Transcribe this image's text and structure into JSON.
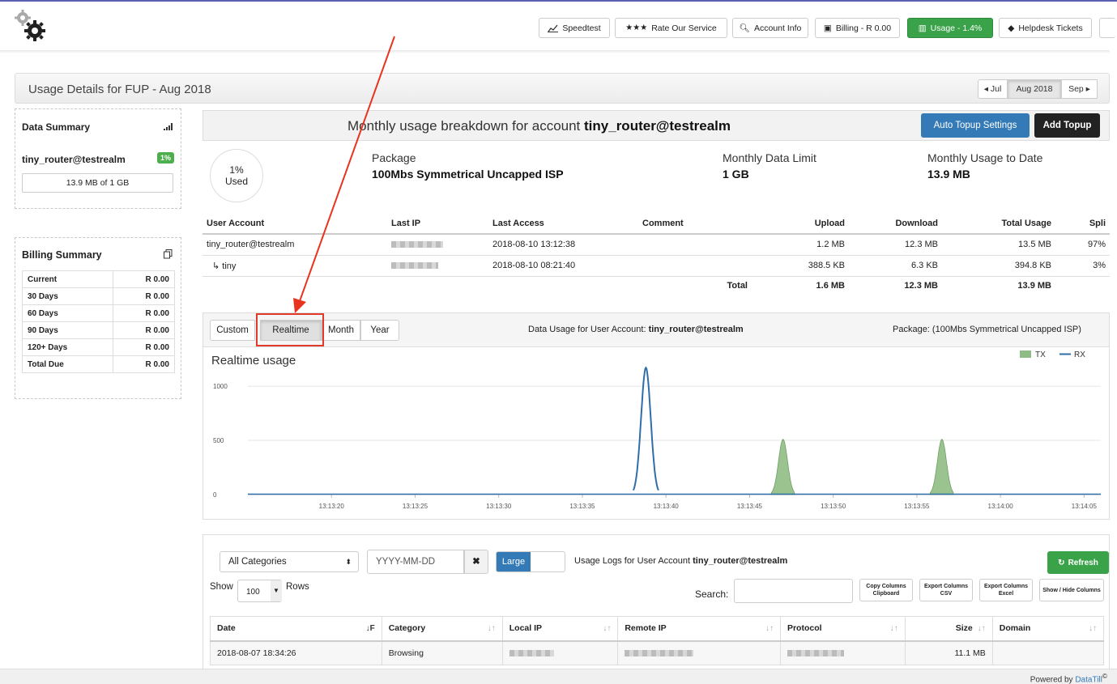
{
  "nav": {
    "speedtest": "Speedtest",
    "rate": "Rate Our Service",
    "account": "Account Info",
    "billing": "Billing - R 0.00",
    "usage": "Usage - 1.4%",
    "helpdesk": "Helpdesk Tickets"
  },
  "header": {
    "title": "Usage Details for FUP - Aug 2018",
    "prev": "◂ Jul",
    "current": "Aug 2018",
    "next": "Sep ▸"
  },
  "data_summary": {
    "title": "Data Summary",
    "user": "tiny_router@testrealm",
    "percent": "1%",
    "usage": "13.9 MB of 1 GB"
  },
  "billing_summary": {
    "title": "Billing Summary",
    "rows": [
      {
        "label": "Current",
        "value": "R 0.00"
      },
      {
        "label": "30 Days",
        "value": "R 0.00"
      },
      {
        "label": "60 Days",
        "value": "R 0.00"
      },
      {
        "label": "90 Days",
        "value": "R 0.00"
      },
      {
        "label": "120+ Days",
        "value": "R 0.00"
      },
      {
        "label": "Total Due",
        "value": "R 0.00"
      }
    ]
  },
  "breakdown": {
    "title_prefix": "Monthly usage breakdown for account ",
    "account": "tiny_router@testrealm",
    "auto_topup": "Auto Topup Settings",
    "add_topup": "Add Topup",
    "used_pct": "1%",
    "used_label": "Used",
    "package_label": "Package",
    "package_value": "100Mbs Symmetrical Uncapped ISP",
    "limit_label": "Monthly Data Limit",
    "limit_value": "1 GB",
    "todate_label": "Monthly Usage to Date",
    "todate_value": "13.9 MB"
  },
  "accounts_table": {
    "headers": [
      "User Account",
      "Last IP",
      "Last Access",
      "Comment",
      "Upload",
      "Download",
      "Total Usage",
      "Spli"
    ],
    "rows": [
      {
        "account": "tiny_router@testrealm",
        "last_access": "2018-08-10 13:12:38",
        "upload": "1.2 MB",
        "download": "12.3 MB",
        "total": "13.5 MB",
        "split": "97%"
      },
      {
        "account": "↳ tiny",
        "last_access": "2018-08-10 08:21:40",
        "upload": "388.5 KB",
        "download": "6.3 KB",
        "total": "394.8 KB",
        "split": "3%"
      }
    ],
    "total_label": "Total",
    "total_upload": "1.6 MB",
    "total_download": "12.3 MB",
    "total_usage": "13.9 MB"
  },
  "chart_panel": {
    "tabs": [
      "Custom",
      "Realtime",
      "Month",
      "Year"
    ],
    "active_tab": "Realtime",
    "account_prefix": "Data Usage for User Account: ",
    "account": "tiny_router@testrealm",
    "package": "Package:  (100Mbs Symmetrical Uncapped ISP)"
  },
  "chart_data": {
    "type": "area",
    "title": "Realtime usage",
    "legend_position": "top-right",
    "ylim": [
      0,
      1150
    ],
    "y_ticks": [
      0,
      500,
      1000
    ],
    "x_ticks": [
      "13:13:20",
      "13:13:25",
      "13:13:30",
      "13:13:35",
      "13:13:40",
      "13:13:45",
      "13:13:50",
      "13:13:55",
      "13:14:00",
      "13:14:05"
    ],
    "x_range_seconds": [
      15,
      66
    ],
    "series": [
      {
        "name": "TX",
        "color": "#8fbc84",
        "peaks": [
          {
            "t": 47,
            "value": 510
          },
          {
            "t": 56.5,
            "value": 510
          }
        ]
      },
      {
        "name": "RX",
        "color": "#2f6ea8",
        "peaks": [
          {
            "t": 38.8,
            "value": 1170
          }
        ]
      }
    ]
  },
  "logs": {
    "category": "All Categories",
    "date_placeholder": "YYYY-MM-DD",
    "large": "Large",
    "title_prefix": "Usage Logs for User Account ",
    "account": "tiny_router@testrealm",
    "refresh": "Refresh",
    "show": "Show",
    "rows_count": "100",
    "rows_label": "Rows",
    "search_label": "Search:",
    "btn_copy": "Copy Columns Clipboard",
    "btn_csv": "Export Columns CSV",
    "btn_excel": "Export Columns Excel",
    "btn_showhide": "Show / Hide Columns",
    "headers": [
      "Date",
      "Category",
      "Local IP",
      "Remote IP",
      "Protocol",
      "Size",
      "Domain"
    ],
    "row": {
      "date": "2018-08-07 18:34:26",
      "category": "Browsing",
      "size": "11.1 MB"
    }
  },
  "footer": {
    "powered": "Powered by ",
    "brand": "DataTill",
    "mark": "©"
  }
}
